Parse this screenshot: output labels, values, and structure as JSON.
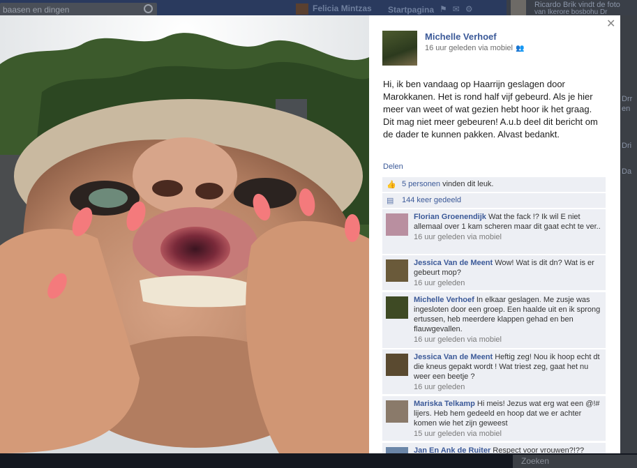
{
  "background": {
    "search_text": "baasen en dingen",
    "user_name": "Felicia Mintzas",
    "home_label": "Startpagina",
    "notification_text": "Ricardo Brik vindt de foto",
    "notification_text2": "van Ikerore bosbohu Dr",
    "side_snippets": [
      "Drr",
      "en",
      "Dri",
      "Da"
    ],
    "chat_label": "Zoeken"
  },
  "post": {
    "author": "Michelle Verhoef",
    "meta": "16 uur geleden via mobiel",
    "text": "Hi, ik ben vandaag op Haarrijn geslagen door Marokkanen. Het is rond half vijf gebeurd. Als je hier meer van weet of wat gezien hebt hoor ik het graag. Dit mag niet meer gebeuren! A.u.b deel dit bericht om de dader te kunnen pakken. Alvast bedankt.",
    "share_label": "Delen",
    "likes_count": "5 personen",
    "likes_suffix": "vinden dit leuk.",
    "shares": "144 keer gedeeld"
  },
  "comments": [
    {
      "author": "Florian Groenendijk",
      "text": "Wat the fack !? Ik wil E niet allemaal over 1 kam scheren maar dit gaat echt te ver..",
      "time": "16 uur geleden via mobiel",
      "avatar_color": "#b98fa0"
    },
    {
      "author": "Jessica Van de Meent",
      "text": "Wow! Wat is dit dn? Wat is er gebeurt mop?",
      "time": "16 uur geleden",
      "avatar_color": "#6a5a3a"
    },
    {
      "author": "Michelle Verhoef",
      "text": "In elkaar geslagen. Me zusje was ingesloten door een groep. Een haalde uit en ik sprong ertussen, heb meerdere klappen gehad en ben flauwgevallen.",
      "time": "16 uur geleden via mobiel",
      "avatar_color": "#3e4a24"
    },
    {
      "author": "Jessica Van de Meent",
      "text": "Heftig zeg! Nou ik hoop echt dt die kneus gepakt wordt ! Wat triest zeg, gaat het nu weer een beetje ?",
      "time": "16 uur geleden",
      "avatar_color": "#5a4a30"
    },
    {
      "author": "Mariska Telkamp",
      "text": "Hi meis! Jezus wat erg wat een @!# lijers. Heb hem gedeeld en hoop dat we er achter komen wie het zijn geweest",
      "time": "15 uur geleden via mobiel",
      "avatar_color": "#8a7a6a"
    },
    {
      "author": "Jan En Ank de Ruiter",
      "text": "Respect voor vrouwen?!??",
      "time": "",
      "avatar_color": "#6b86a8"
    }
  ],
  "colors": {
    "link": "#3b5998",
    "panel_bg": "#edeff4",
    "overlay": "#1e2430"
  },
  "icons": [
    "search-icon",
    "close-icon",
    "like-thumb-icon",
    "share-icon",
    "people-icon"
  ]
}
